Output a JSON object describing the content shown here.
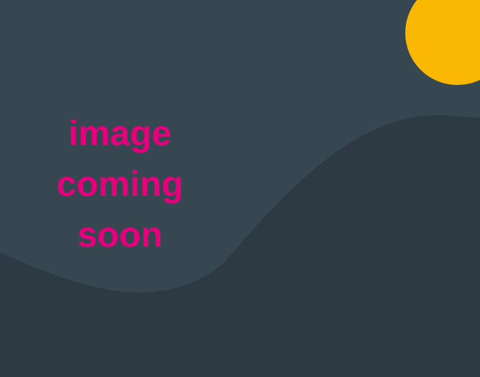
{
  "placeholder": {
    "lines": [
      "image",
      "coming",
      "soon"
    ]
  },
  "colors": {
    "background": "#374751",
    "hill": "#2e3a43",
    "sun": "#fbb802",
    "text": "#e6007e"
  },
  "icons": {
    "sun": "sun-icon",
    "hill": "hill-shape"
  }
}
